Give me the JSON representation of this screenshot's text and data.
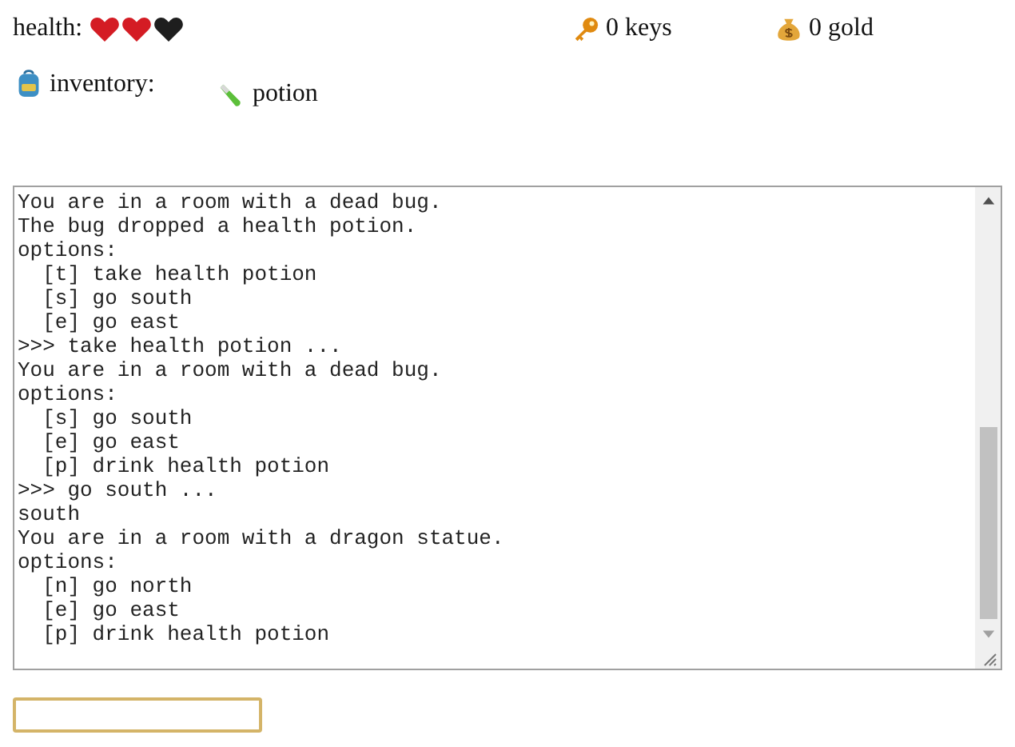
{
  "health": {
    "label": "health:",
    "hearts": [
      {
        "filled": true
      },
      {
        "filled": true
      },
      {
        "filled": false
      }
    ]
  },
  "keys": {
    "text": "0 keys"
  },
  "gold": {
    "text": "0 gold"
  },
  "inventory": {
    "label": "inventory:",
    "items": [
      {
        "text": "potion"
      }
    ]
  },
  "log": {
    "lines": [
      "You are in a room with a dead bug.",
      "The bug dropped a health potion.",
      "options:",
      "  [t] take health potion",
      "  [s] go south",
      "  [e] go east",
      ">>> take health potion ...",
      "You are in a room with a dead bug.",
      "options:",
      "  [s] go south",
      "  [e] go east",
      "  [p] drink health potion",
      ">>> go south ...",
      "south",
      "You are in a room with a dragon statue.",
      "options:",
      "  [n] go north",
      "  [e] go east",
      "  [p] drink health potion"
    ]
  }
}
